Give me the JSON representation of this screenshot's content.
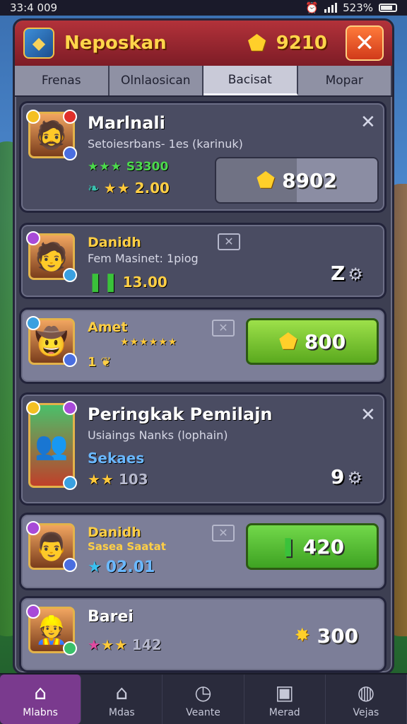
{
  "status": {
    "time": "33:4 009",
    "battery": "523%"
  },
  "header": {
    "title": "Neposkan",
    "coins": "9210",
    "close_label": "✕"
  },
  "tabs": [
    {
      "label": "Frenas",
      "active": false
    },
    {
      "label": "Olnlaosican",
      "active": false
    },
    {
      "label": "Bacisat",
      "active": true
    },
    {
      "label": "Mopar",
      "active": false
    }
  ],
  "cards": [
    {
      "name": "Marlnali",
      "sub": "Setoiesrbans- 1es (karinuk)",
      "stat1": "S3300",
      "stat2": "2.00",
      "price": "8902"
    },
    {
      "name": "Danidh",
      "sub": "Fem Masinet: 1piog",
      "stat1": "13.00",
      "side": "Z"
    },
    {
      "name": "Amet",
      "stat1": "1",
      "price": "800"
    },
    {
      "name": "Peringkak Pemilajn",
      "sub": "Usiaings Nanks (lophain)",
      "tag": "Sekaes",
      "stat1": "103",
      "side": "9"
    },
    {
      "name": "Danidh",
      "sub": "Sasea Saatat",
      "stat1": "02.01",
      "price": "420"
    },
    {
      "name": "Barei",
      "stat1": "142",
      "price": "300"
    }
  ],
  "nav": [
    {
      "label": "Mlabns",
      "icon": "home-icon",
      "active": true
    },
    {
      "label": "Mdas",
      "icon": "house-icon",
      "active": false
    },
    {
      "label": "Veante",
      "icon": "clock-icon",
      "active": false
    },
    {
      "label": "Merad",
      "icon": "chest-icon",
      "active": false
    },
    {
      "label": "Vejas",
      "icon": "chat-icon",
      "active": false
    }
  ],
  "colors": {
    "accent_red": "#b3323a",
    "gold": "#ffcf45",
    "green_btn": "#5aa91e",
    "nav_active": "#7a3a8e"
  }
}
